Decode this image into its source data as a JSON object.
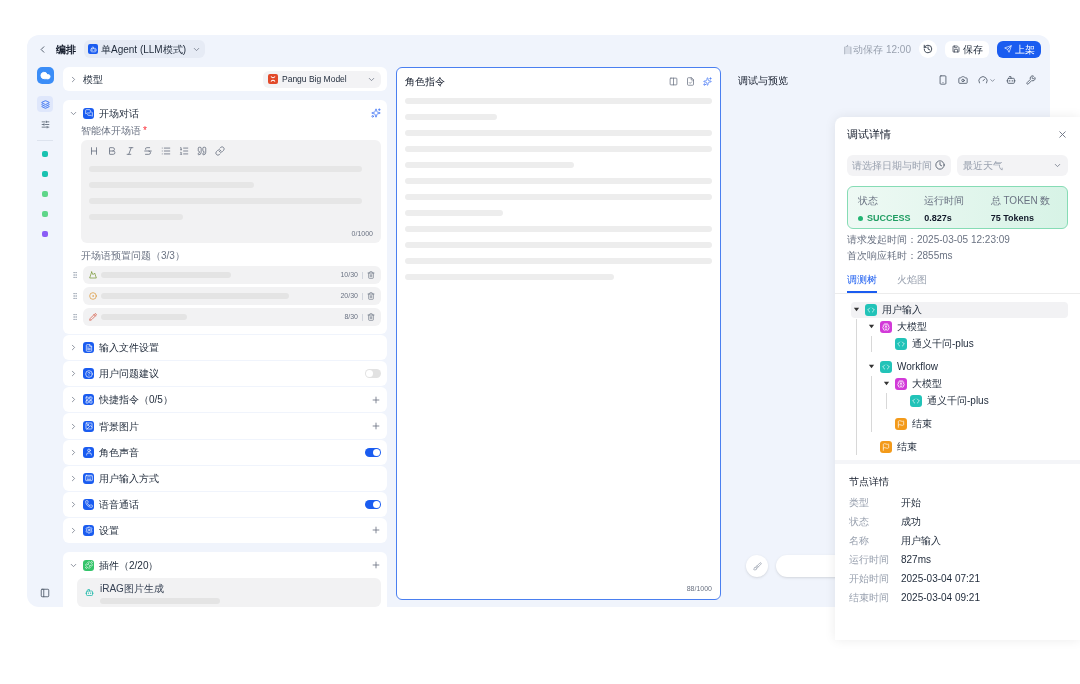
{
  "header": {
    "title": "编排",
    "agent_select": "单Agent (LLM模式)",
    "autosave": "自动保存 12:00",
    "buttons": [
      {
        "label": "保存",
        "kind": "secondary"
      },
      {
        "label": "上架",
        "kind": "primary"
      }
    ]
  },
  "rail": {
    "items": [
      {
        "selected": true
      },
      {
        "selected": false
      }
    ],
    "dots": [
      {
        "color": "#19c2b0"
      },
      {
        "color": "#19c2b0"
      },
      {
        "color": "#5fd68a"
      },
      {
        "color": "#5fd68a"
      },
      {
        "color": "#8b5cf6"
      }
    ]
  },
  "left_panel": {
    "model": {
      "label": "模型",
      "value": "Pangu Big Model"
    },
    "opening": {
      "title": "开场对话",
      "expanded": true,
      "field_label": "智能体开场语",
      "required_mark": "*",
      "counter": "0/1000",
      "preset_label": "开场语预置问题（3/3）",
      "presets": [
        {
          "counter": "10/30"
        },
        {
          "counter": "20/30"
        },
        {
          "counter": "8/30"
        }
      ]
    },
    "sections": [
      {
        "title": "输入文件设置",
        "kind": "none"
      },
      {
        "title": "用户问题建议",
        "kind": "toggle",
        "on": false
      },
      {
        "title": "快捷指令（0/5）",
        "kind": "plus"
      },
      {
        "title": "背景图片",
        "kind": "plus"
      },
      {
        "title": "角色声音",
        "kind": "toggle",
        "on": true
      },
      {
        "title": "用户输入方式",
        "kind": "none"
      },
      {
        "title": "语音通话",
        "kind": "toggle",
        "on": true
      },
      {
        "title": "设置",
        "kind": "plus"
      }
    ],
    "plugins": {
      "title": "插件（2/20）",
      "expanded": true,
      "items": [
        {
          "name": "iRAG图片生成"
        }
      ]
    }
  },
  "instructions": {
    "title": "角色指令",
    "counter": "88/1000"
  },
  "preview": {
    "title": "调试与预览"
  },
  "debug": {
    "title": "调试详情",
    "date_placeholder": "请选择日期与时间",
    "select": "最近天气",
    "stats": [
      {
        "label": "状态",
        "value": "SUCCESS",
        "kind": "status"
      },
      {
        "label": "运行时间",
        "value": "0.827s",
        "kind": "plain"
      },
      {
        "label": "总 TOKEN 数",
        "value": "75 Tokens",
        "kind": "plain"
      }
    ],
    "info": [
      "请求发起时间：2025-03-05 12:23:09",
      "首次响应耗时：2855ms"
    ],
    "tabs": [
      {
        "label": "调测树",
        "selected": true
      },
      {
        "label": "火焰图",
        "selected": false
      }
    ],
    "tree": [
      {
        "label": "用户输入",
        "kind": "code",
        "expanded": true,
        "selected": true,
        "children": [
          {
            "label": "大模型",
            "kind": "llm",
            "expanded": true,
            "selected": false,
            "children": [
              {
                "label": "通义千问-plus",
                "kind": "code",
                "selected": false
              }
            ]
          },
          {
            "label": "Workflow",
            "kind": "code",
            "expanded": true,
            "selected": false,
            "children": [
              {
                "label": "大模型",
                "kind": "llm",
                "expanded": true,
                "selected": false,
                "children": [
                  {
                    "label": "通义千问-plus",
                    "kind": "code",
                    "selected": false
                  }
                ]
              },
              {
                "label": "结束",
                "kind": "end",
                "selected": false
              }
            ]
          },
          {
            "label": "结束",
            "kind": "end",
            "selected": false
          }
        ]
      }
    ],
    "node_title": "节点详情",
    "node_rows": [
      {
        "label": "类型",
        "value": "开始"
      },
      {
        "label": "状态",
        "value": "成功"
      },
      {
        "label": "名称",
        "value": "用户输入"
      },
      {
        "label": "运行时间",
        "value": "827ms"
      },
      {
        "label": "开始时间",
        "value": "2025-03-04 07:21"
      },
      {
        "label": "结束时间",
        "value": "2025-03-04 09:21"
      }
    ]
  }
}
